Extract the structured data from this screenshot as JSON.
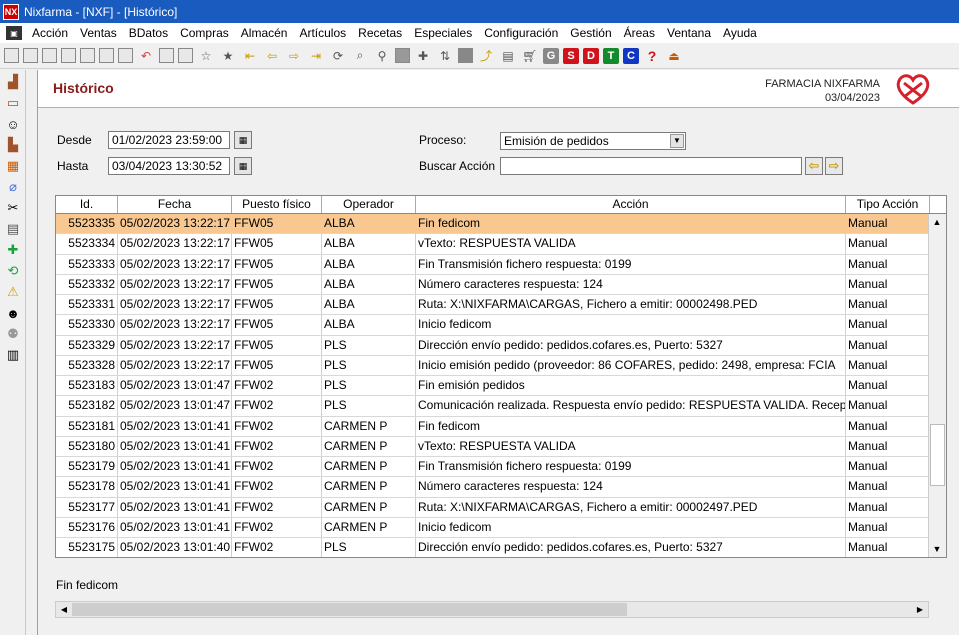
{
  "window": {
    "title": "Nixfarma - [NXF] - [Histórico]",
    "app_icon": "NX"
  },
  "menu": [
    "Acción",
    "Ventas",
    "BDatos",
    "Compras",
    "Almacén",
    "Artículos",
    "Recetas",
    "Especiales",
    "Configuración",
    "Gestión",
    "Áreas",
    "Ventana",
    "Ayuda"
  ],
  "toolbar_letters": {
    "g": "G",
    "s": "S",
    "d": "D",
    "t": "T",
    "c": "C",
    "help": "?"
  },
  "header": {
    "title": "Histórico",
    "pharmacy": "FARMACIA NIXFARMA",
    "date": "03/04/2023"
  },
  "filters": {
    "desde_label": "Desde",
    "desde_value": "01/02/2023 23:59:00",
    "hasta_label": "Hasta",
    "hasta_value": "03/04/2023 13:30:52",
    "proceso_label": "Proceso:",
    "proceso_value": "Emisión de pedidos",
    "buscar_label": "Buscar Acción",
    "buscar_value": ""
  },
  "table": {
    "columns": [
      "Id.",
      "Fecha",
      "Puesto físico",
      "Operador",
      "Acción",
      "Tipo Acción"
    ],
    "rows": [
      [
        "5523335",
        "05/02/2023 13:22:17",
        "FFW05",
        "ALBA",
        "Fin fedicom",
        "Manual"
      ],
      [
        "5523334",
        "05/02/2023 13:22:17",
        "FFW05",
        "ALBA",
        "vTexto: RESPUESTA VALIDA",
        "Manual"
      ],
      [
        "5523333",
        "05/02/2023 13:22:17",
        "FFW05",
        "ALBA",
        "Fin Transmisión fichero respuesta: 0199",
        "Manual"
      ],
      [
        "5523332",
        "05/02/2023 13:22:17",
        "FFW05",
        "ALBA",
        "Número caracteres respuesta: 124",
        "Manual"
      ],
      [
        "5523331",
        "05/02/2023 13:22:17",
        "FFW05",
        "ALBA",
        "Ruta: X:\\NIXFARMA\\CARGAS, Fichero a emitir: 00002498.PED",
        "Manual"
      ],
      [
        "5523330",
        "05/02/2023 13:22:17",
        "FFW05",
        "ALBA",
        "Inicio fedicom",
        "Manual"
      ],
      [
        "5523329",
        "05/02/2023 13:22:17",
        "FFW05",
        "PLS",
        "Dirección envío pedido: pedidos.cofares.es, Puerto: 5327",
        "Manual"
      ],
      [
        "5523328",
        "05/02/2023 13:22:17",
        "FFW05",
        "PLS",
        "Inicio emisión pedido (proveedor: 86 COFARES, pedido: 2498, empresa: FCIA",
        "Manual"
      ],
      [
        "5523183",
        "05/02/2023 13:01:47",
        "FFW02",
        "PLS",
        "Fin emisión pedidos",
        "Manual"
      ],
      [
        "5523182",
        "05/02/2023 13:01:47",
        "FFW02",
        "PLS",
        "Comunicación realizada. Respuesta envío pedido: RESPUESTA VALIDA. Recepción de p",
        "Manual"
      ],
      [
        "5523181",
        "05/02/2023 13:01:41",
        "FFW02",
        "CARMEN P",
        "Fin fedicom",
        "Manual"
      ],
      [
        "5523180",
        "05/02/2023 13:01:41",
        "FFW02",
        "CARMEN P",
        "vTexto: RESPUESTA VALIDA",
        "Manual"
      ],
      [
        "5523179",
        "05/02/2023 13:01:41",
        "FFW02",
        "CARMEN P",
        "Fin Transmisión fichero respuesta: 0199",
        "Manual"
      ],
      [
        "5523178",
        "05/02/2023 13:01:41",
        "FFW02",
        "CARMEN P",
        "Número caracteres respuesta: 124",
        "Manual"
      ],
      [
        "5523177",
        "05/02/2023 13:01:41",
        "FFW02",
        "CARMEN P",
        "Ruta: X:\\NIXFARMA\\CARGAS, Fichero a emitir: 00002497.PED",
        "Manual"
      ],
      [
        "5523176",
        "05/02/2023 13:01:41",
        "FFW02",
        "CARMEN P",
        "Inicio fedicom",
        "Manual"
      ],
      [
        "5523175",
        "05/02/2023 13:01:40",
        "FFW02",
        "PLS",
        "Dirección envío pedido: pedidos.cofares.es, Puerto: 5327",
        "Manual"
      ]
    ]
  },
  "status_text": "Fin fedicom",
  "colors": {
    "titlebar": "#1a5bbf",
    "header_title": "#8b1a1a",
    "selected_row": "#f9c790",
    "logo": "#d6202c"
  }
}
